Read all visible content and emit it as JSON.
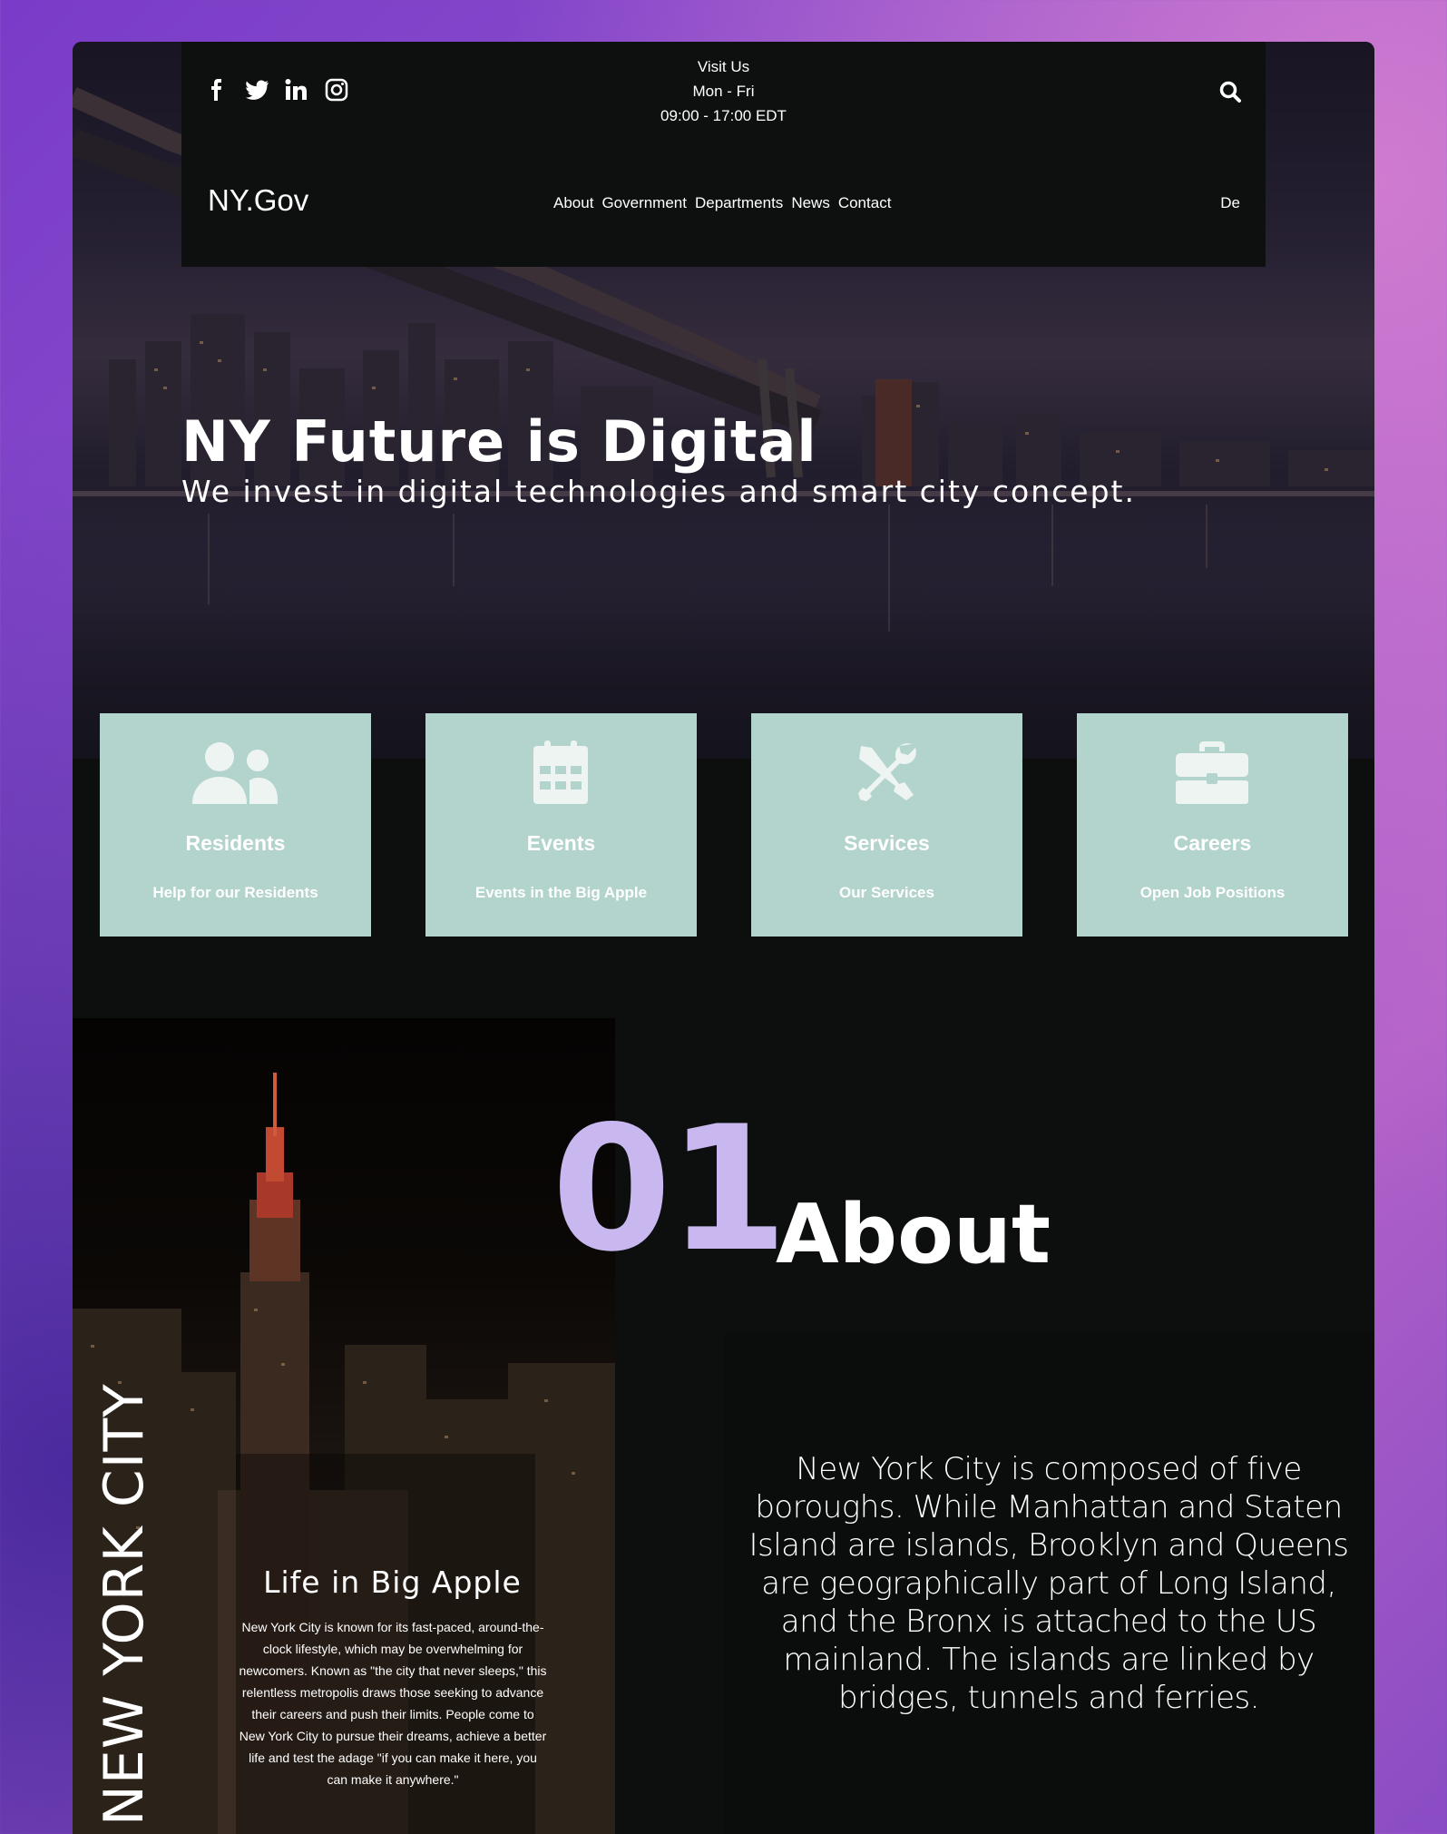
{
  "header": {
    "social": [
      "facebook-icon",
      "twitter-icon",
      "linkedin-icon",
      "instagram-icon"
    ],
    "visit_label": "Visit Us",
    "visit_days": "Mon - Fri",
    "visit_hours": "09:00 - 17:00 EDT",
    "brand": "NY.Gov",
    "nav": [
      "About",
      "Government",
      "Departments",
      "News",
      "Contact"
    ],
    "language": "De"
  },
  "hero": {
    "title": "NY Future is Digital",
    "subtitle": "We invest in digital technologies and smart city concept."
  },
  "cards": [
    {
      "title": "Residents",
      "subtitle": "Help for our Residents",
      "icon": "users-icon"
    },
    {
      "title": "Events",
      "subtitle": "Events in the Big Apple",
      "icon": "calendar-icon"
    },
    {
      "title": "Services",
      "subtitle": "Our Services",
      "icon": "tools-icon"
    },
    {
      "title": "Careers",
      "subtitle": "Open Job Positions",
      "icon": "briefcase-icon"
    }
  ],
  "about": {
    "number": "01",
    "title": "About",
    "side_label": "NEW YORK CITY",
    "life_title": "Life in Big Apple",
    "life_text": "New York City is known for its fast-paced, around-the-clock lifestyle, which may be overwhelming for newcomers. Known as \"the city that never sleeps,\" this relentless metropolis draws those seeking to advance their careers and push their limits. People come to New York City to pursue their dreams, achieve a better life and test the adage \"if you can make it here, you can make it anywhere.\"",
    "body": "New York City is composed of five boroughs. While Manhattan and Staten Island are islands, Brooklyn and Queens are geographically part of Long Island, and the Bronx is attached to the US mainland. The islands are linked by bridges, tunnels and ferries."
  },
  "colors": {
    "card_bg": "#b3d4cc",
    "accent_number": "#c9b8ef",
    "frame_bg": "#0d0f0f"
  }
}
